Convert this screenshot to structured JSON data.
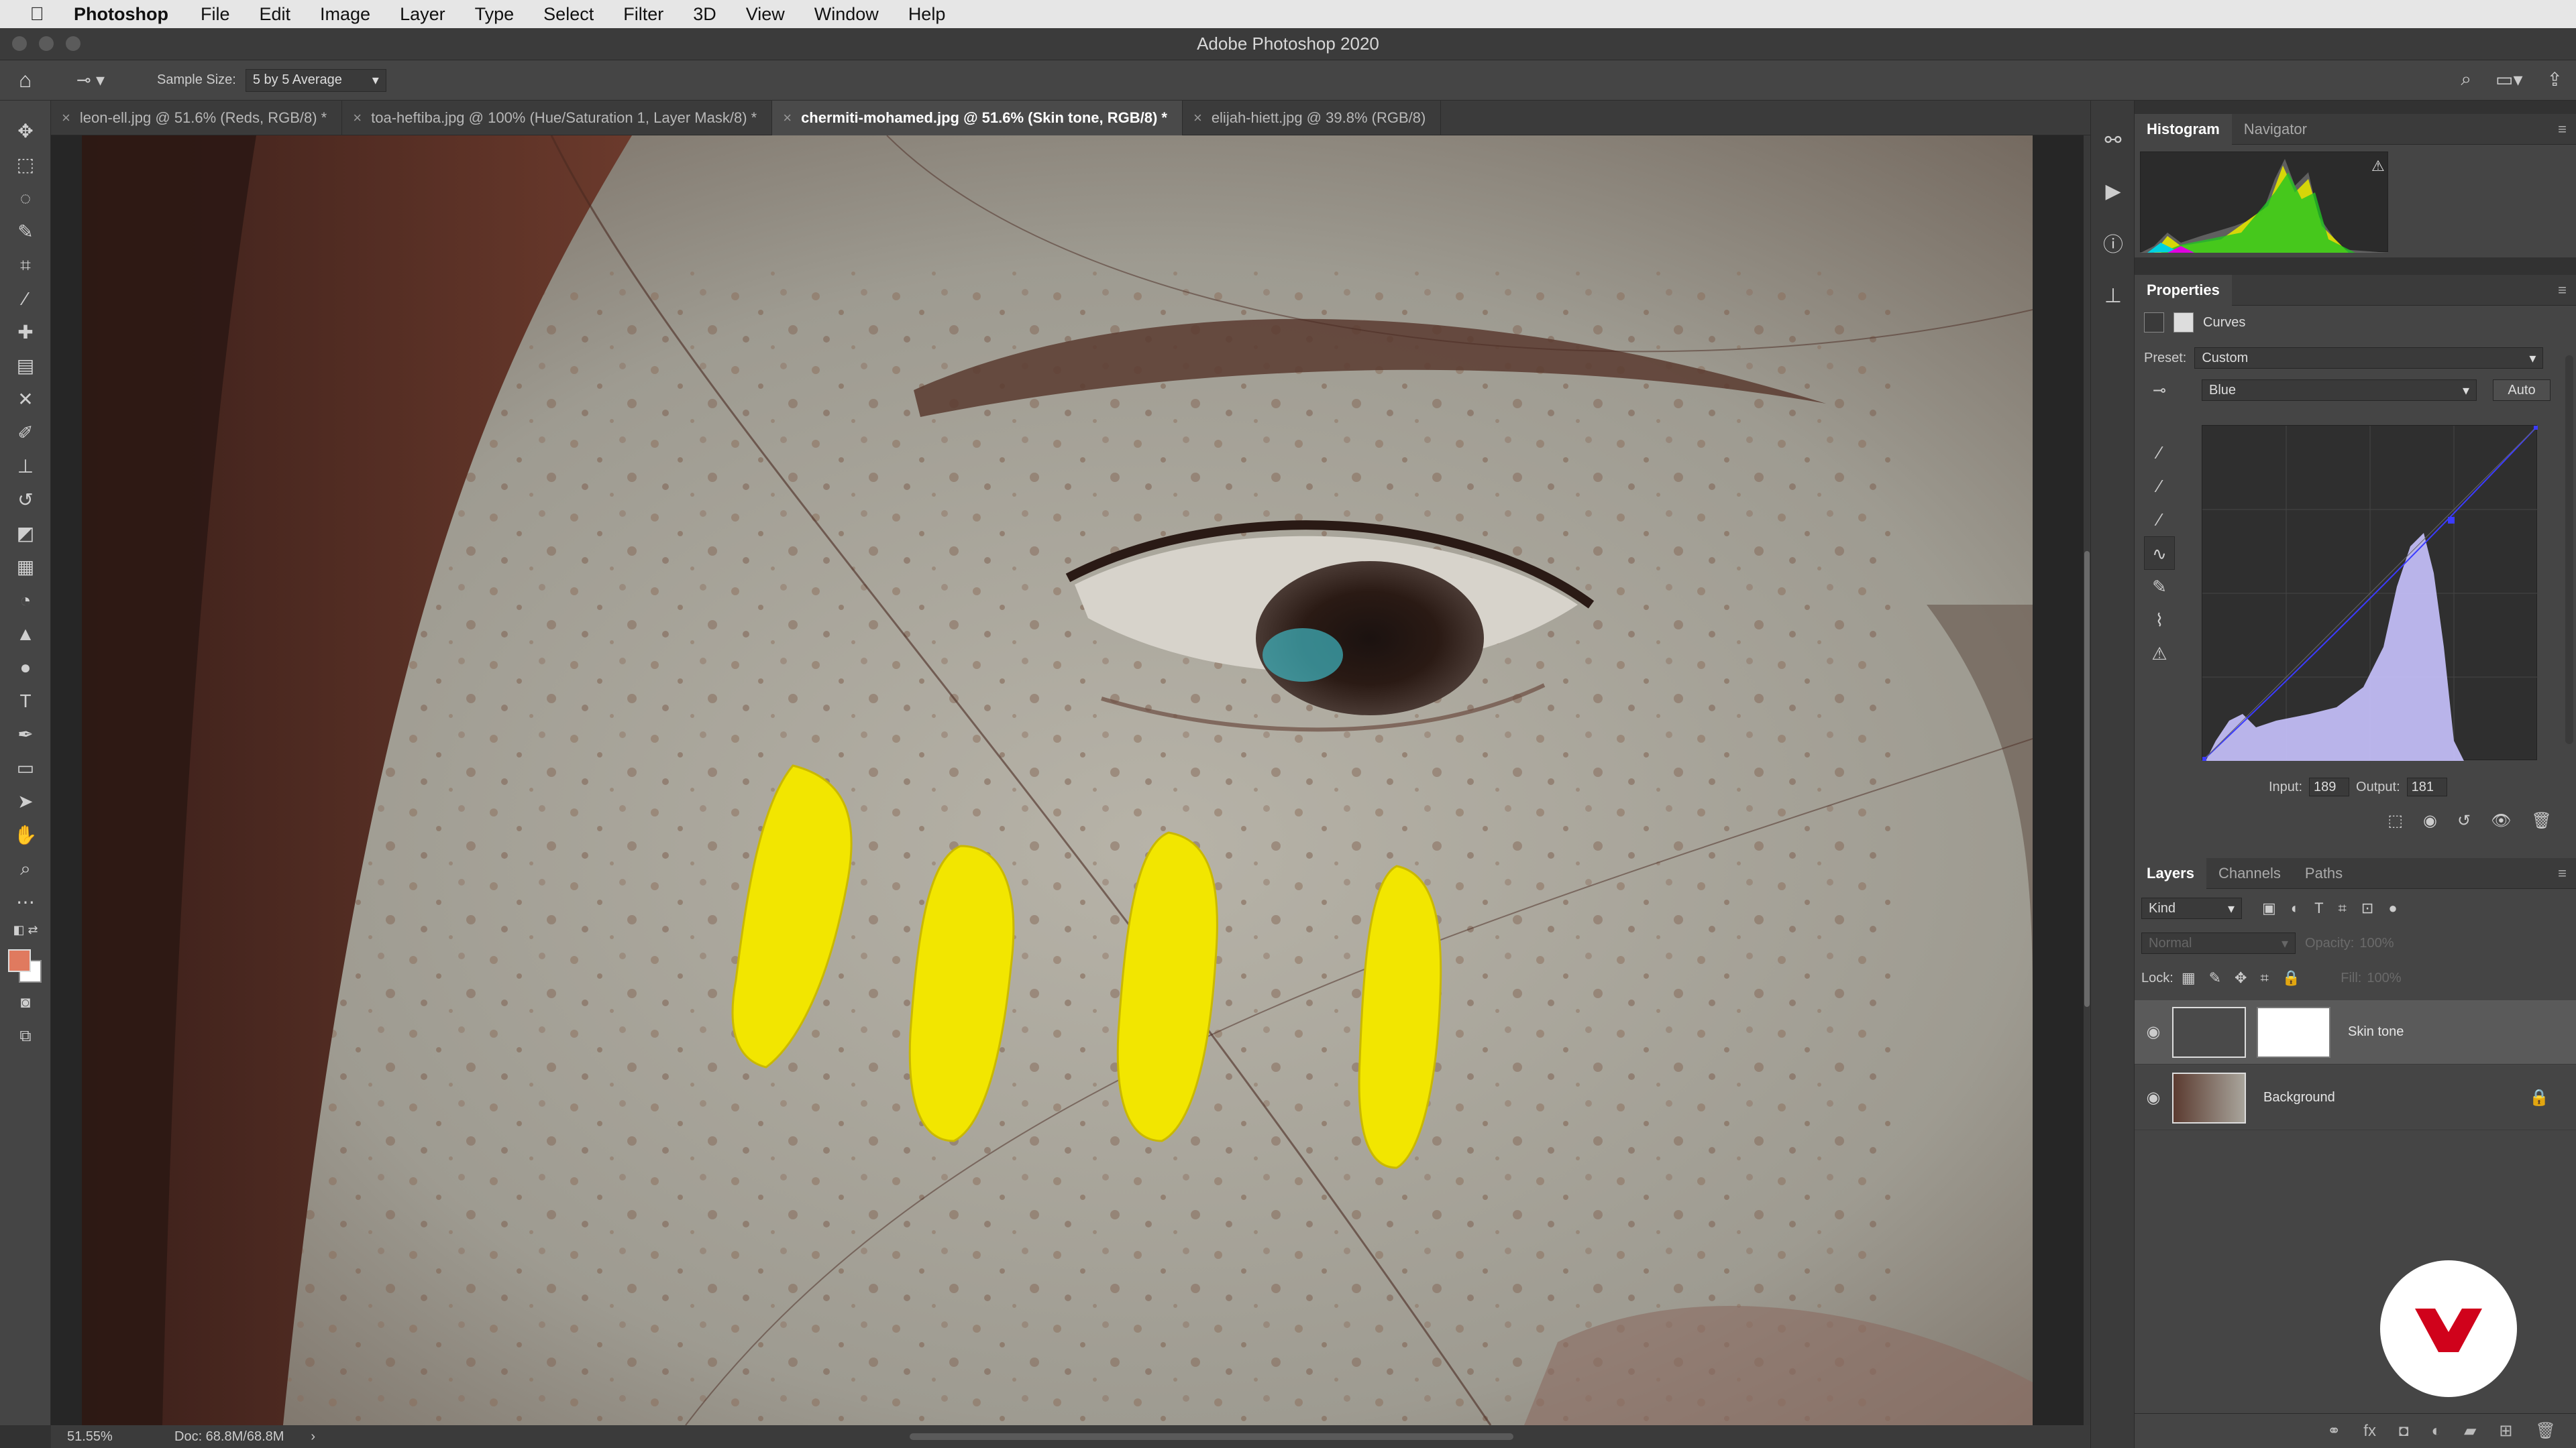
{
  "menubar": {
    "apple": "",
    "app_name": "Photoshop",
    "items": [
      "File",
      "Edit",
      "Image",
      "Layer",
      "Type",
      "Select",
      "Filter",
      "3D",
      "View",
      "Window",
      "Help"
    ]
  },
  "window": {
    "title": "Adobe Photoshop 2020"
  },
  "options_bar": {
    "sample_size_label": "Sample Size:",
    "sample_size_value": "5 by 5 Average"
  },
  "tabs": [
    {
      "label": "leon-ell.jpg @ 51.6% (Reds, RGB/8) *",
      "active": false
    },
    {
      "label": "toa-heftiba.jpg @ 100% (Hue/Saturation 1, Layer Mask/8) *",
      "active": false
    },
    {
      "label": "chermiti-mohamed.jpg @ 51.6% (Skin tone, RGB/8) *",
      "active": true
    },
    {
      "label": "elijah-hiett.jpg @ 39.8% (RGB/8)",
      "active": false
    }
  ],
  "status": {
    "zoom": "51.55%",
    "doc": "Doc: 68.8M/68.8M",
    "arrow": "›"
  },
  "histogram_panel": {
    "tabs": [
      "Histogram",
      "Navigator"
    ]
  },
  "properties_panel": {
    "title": "Properties",
    "adjustment": "Curves",
    "preset_label": "Preset:",
    "preset_value": "Custom",
    "channel_value": "Blue",
    "auto_label": "Auto",
    "input_label": "Input:",
    "input_value": "189",
    "output_label": "Output:",
    "output_value": "181",
    "curve_point": {
      "input": 189,
      "output": 181
    }
  },
  "layers_panel": {
    "tabs": [
      "Layers",
      "Channels",
      "Paths"
    ],
    "filter_kind": "Kind",
    "blend_mode": "Normal",
    "opacity_label": "Opacity:",
    "opacity_value": "100%",
    "lock_label": "Lock:",
    "fill_label": "Fill:",
    "fill_value": "100%",
    "layers": [
      {
        "name": "Skin tone",
        "selected": true
      },
      {
        "name": "Background",
        "selected": false,
        "locked": true
      }
    ]
  },
  "colors": {
    "foreground": "#e07a5f",
    "background": "#ffffff",
    "accent_logo": "#d0021b"
  }
}
